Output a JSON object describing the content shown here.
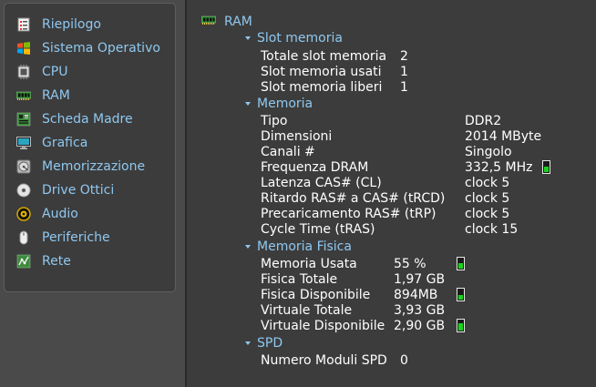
{
  "sidebar": {
    "items": [
      {
        "label": "Riepilogo",
        "icon": "summary-icon"
      },
      {
        "label": "Sistema Operativo",
        "icon": "windows-icon"
      },
      {
        "label": "CPU",
        "icon": "cpu-icon"
      },
      {
        "label": "RAM",
        "icon": "ram-icon"
      },
      {
        "label": "Scheda Madre",
        "icon": "motherboard-icon"
      },
      {
        "label": "Grafica",
        "icon": "monitor-icon"
      },
      {
        "label": "Memorizzazione",
        "icon": "hard-disk-icon"
      },
      {
        "label": "Drive Ottici",
        "icon": "optical-disc-icon"
      },
      {
        "label": "Audio",
        "icon": "speaker-icon"
      },
      {
        "label": "Periferiche",
        "icon": "mouse-icon"
      },
      {
        "label": "Rete",
        "icon": "network-icon"
      }
    ]
  },
  "main": {
    "title": "RAM",
    "title_icon": "ram-icon",
    "sections": {
      "slot": {
        "label": "Slot memoria",
        "rows": [
          {
            "k": "Totale slot memoria",
            "v": "2"
          },
          {
            "k": "Slot memoria usati",
            "v": "1"
          },
          {
            "k": "Slot memoria liberi",
            "v": "1"
          }
        ]
      },
      "memoria": {
        "label": "Memoria",
        "rows": [
          {
            "k": "Tipo",
            "v": "DDR2"
          },
          {
            "k": "Dimensioni",
            "v": "2014 MByte"
          },
          {
            "k": "Canali #",
            "v": "Singolo"
          },
          {
            "k": "Frequenza DRAM",
            "v": "332,5 MHz",
            "gauge_level": 0.55
          },
          {
            "k": "Latenza CAS# (CL)",
            "v": "clock 5"
          },
          {
            "k": "Ritardo RAS# a CAS# (tRCD)",
            "v": "clock 5"
          },
          {
            "k": "Precaricamento RAS# (tRP)",
            "v": "clock 5"
          },
          {
            "k": "Cycle Time (tRAS)",
            "v": "clock 15"
          }
        ]
      },
      "fisica": {
        "label": "Memoria Fisica",
        "rows": [
          {
            "k": "Memoria Usata",
            "v": "55 %",
            "gauge_level": 0.55
          },
          {
            "k": "Fisica Totale",
            "v": "1,97 GB"
          },
          {
            "k": "Fisica Disponibile",
            "v": "894MB",
            "gauge_level": 0.45
          },
          {
            "k": "Virtuale Totale",
            "v": "3,93 GB"
          },
          {
            "k": "Virtuale Disponibile",
            "v": "2,90 GB",
            "gauge_level": 0.74
          }
        ]
      },
      "spd": {
        "label": "SPD",
        "rows": [
          {
            "k": "Numero Moduli SPD",
            "v": "0"
          }
        ]
      }
    }
  },
  "colors": {
    "accent_text": "#8fc8f0",
    "background": "#3c3c3c",
    "gauge_fill": "#1bd11b"
  }
}
